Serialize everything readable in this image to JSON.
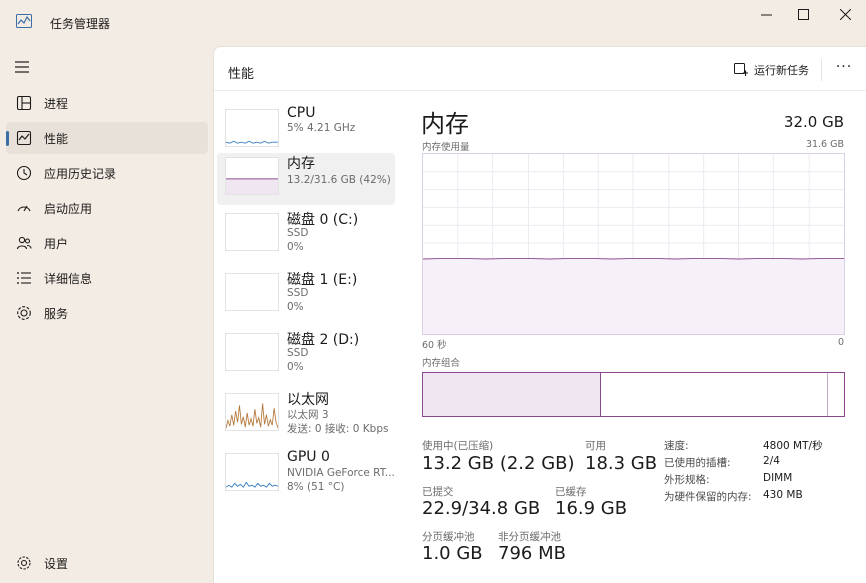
{
  "window": {
    "title": "任务管理器",
    "controls": {
      "minimize": "—",
      "maximize": "☐",
      "close": "✕"
    }
  },
  "nav": {
    "items": [
      {
        "label": "进程",
        "icon": "processes-icon"
      },
      {
        "label": "性能",
        "icon": "performance-icon",
        "active": true
      },
      {
        "label": "应用历史记录",
        "icon": "app-history-icon"
      },
      {
        "label": "启动应用",
        "icon": "startup-icon"
      },
      {
        "label": "用户",
        "icon": "users-icon"
      },
      {
        "label": "详细信息",
        "icon": "details-icon"
      },
      {
        "label": "服务",
        "icon": "services-icon"
      }
    ],
    "settings": "设置"
  },
  "header": {
    "title": "性能",
    "run_task": "运行新任务",
    "more": "···"
  },
  "resources": [
    {
      "name": "CPU",
      "sub1": "5%  4.21 GHz",
      "sub2": ""
    },
    {
      "name": "内存",
      "sub1": "13.2/31.6 GB (42%)",
      "sub2": "",
      "selected": true
    },
    {
      "name": "磁盘 0 (C:)",
      "sub1": "SSD",
      "sub2": "0%"
    },
    {
      "name": "磁盘 1 (E:)",
      "sub1": "SSD",
      "sub2": "0%"
    },
    {
      "name": "磁盘 2 (D:)",
      "sub1": "SSD",
      "sub2": "0%"
    },
    {
      "name": "以太网",
      "sub1": "以太网 3",
      "sub2": "发送: 0  接收: 0 Kbps"
    },
    {
      "name": "GPU 0",
      "sub1": "NVIDIA GeForce RT...",
      "sub2": "8%  (51 °C)"
    }
  ],
  "detail": {
    "title": "内存",
    "total": "32.0 GB",
    "usage_label": "内存使用量",
    "usage_max": "31.6 GB",
    "time_left": "60 秒",
    "time_right": "0",
    "composition_label": "内存组合",
    "usage_fraction": 0.42,
    "colors": {
      "accent": "#8b4a8f",
      "fill": "#efe6f2"
    }
  },
  "stats": {
    "in_use_label": "使用中(已压缩)",
    "in_use_value": "13.2 GB (2.2 GB)",
    "available_label": "可用",
    "available_value": "18.3 GB",
    "committed_label": "已提交",
    "committed_value": "22.9/34.8 GB",
    "cached_label": "已缓存",
    "cached_value": "16.9 GB",
    "paged_label": "分页缓冲池",
    "paged_value": "1.0 GB",
    "nonpaged_label": "非分页缓冲池",
    "nonpaged_value": "796 MB"
  },
  "specs": {
    "speed_label": "速度:",
    "speed_value": "4800 MT/秒",
    "slots_label": "已使用的插槽:",
    "slots_value": "2/4",
    "form_label": "外形规格:",
    "form_value": "DIMM",
    "reserved_label": "为硬件保留的内存:",
    "reserved_value": "430 MB"
  }
}
